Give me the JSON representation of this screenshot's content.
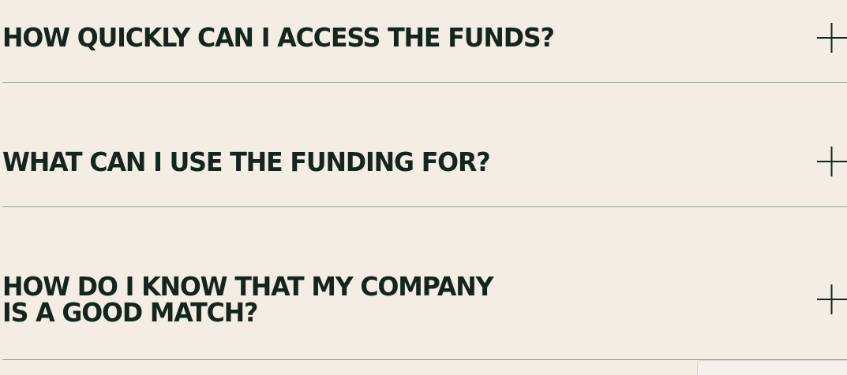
{
  "faq": {
    "items": [
      {
        "question": "HOW QUICKLY CAN I ACCESS THE FUNDS?",
        "toggle_icon": "plus-icon"
      },
      {
        "question": "WHAT CAN I USE THE FUNDING FOR?",
        "toggle_icon": "plus-icon"
      },
      {
        "question_line1": "HOW DO I KNOW THAT MY COMPANY",
        "question_line2": "IS A GOOD MATCH?",
        "toggle_icon": "plus-icon"
      }
    ]
  },
  "colors": {
    "background": "#f3ede4",
    "text": "#13251c",
    "divider": "#9aa296"
  }
}
